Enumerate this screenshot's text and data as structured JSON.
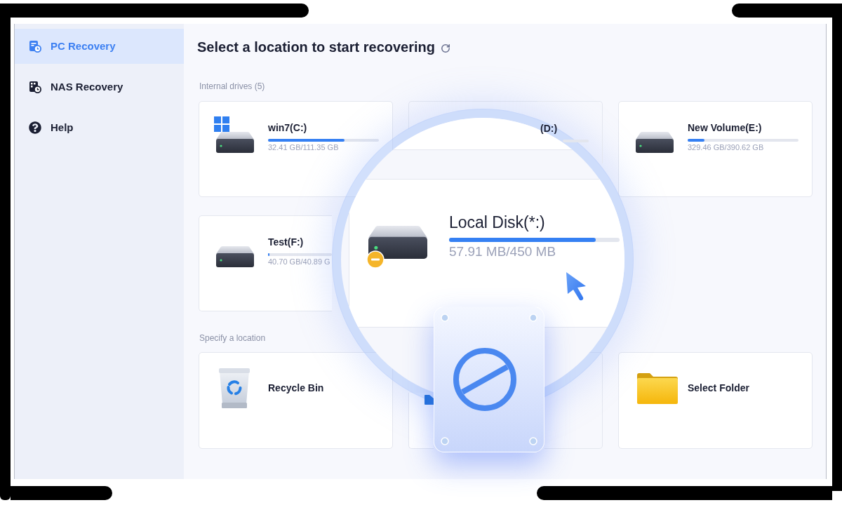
{
  "sidebar": {
    "items": [
      {
        "kind": "pc",
        "label": "PC Recovery",
        "selected": true
      },
      {
        "kind": "nas",
        "label": "NAS Recovery",
        "selected": false
      },
      {
        "kind": "help",
        "label": "Help",
        "selected": false
      }
    ]
  },
  "header": {
    "title": "Select a location to start recovering"
  },
  "internal_drives": {
    "heading": "Internal drives (5)",
    "drives": [
      {
        "kind": "drive",
        "name": "win7(C:)",
        "system": true,
        "level": 0.69,
        "reading": "32.41 GB/111.35 GB"
      },
      {
        "kind": "covered",
        "name": "(D:)"
      },
      {
        "kind": "drive",
        "name": "New Volume(E:)",
        "system": false,
        "level": 0.15,
        "reading": "329.46 GB/390.62 GB"
      },
      {
        "kind": "cut",
        "name": "Test(F:)",
        "system": false,
        "level": 0.02,
        "reading": "40.70 GB/40.89 G"
      }
    ]
  },
  "magnifier": {
    "name": "Local Disk(*:)",
    "warning": true,
    "level": 0.86,
    "reading": "57.91 MB/450 MB"
  },
  "locations": {
    "heading": "Specify a location",
    "items": [
      {
        "kind": "recycle",
        "label": "Recycle Bin"
      },
      {
        "kind": "covered"
      },
      {
        "kind": "folder",
        "label": "Select Folder"
      }
    ]
  }
}
